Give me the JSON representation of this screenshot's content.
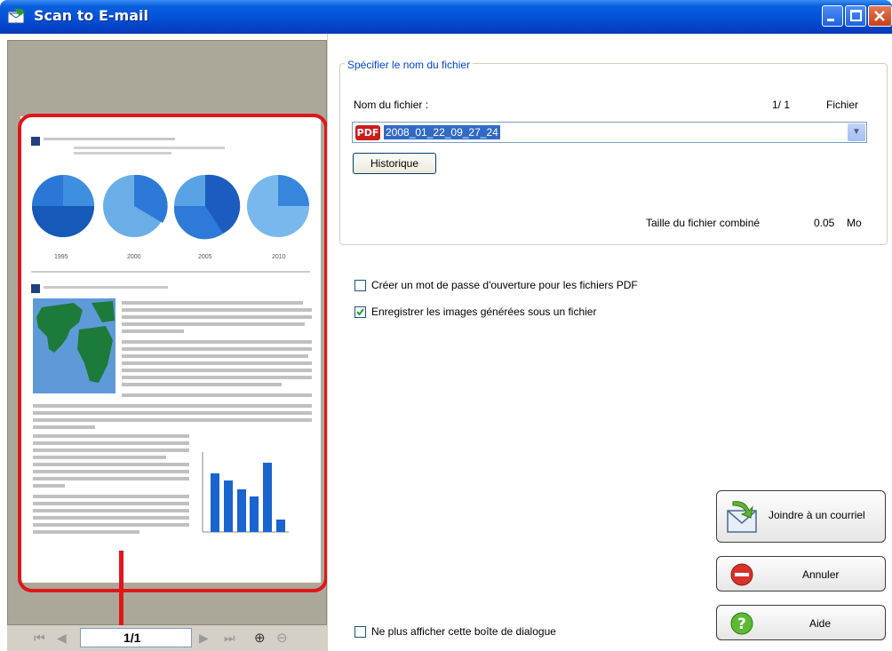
{
  "window": {
    "title": "Scan to E-mail"
  },
  "preview": {
    "page_indicator": "1/1",
    "chart_years": [
      "1995",
      "2000",
      "2005",
      "2010"
    ]
  },
  "file_group": {
    "legend": "Spécifier le nom du fichier",
    "filename_label": "Nom du fichier :",
    "file_counter": "1/ 1",
    "file_unit": "Fichier",
    "filename_value": "2008_01_22_09_27_24",
    "pdf_badge": "PDF",
    "history_button": "Historique",
    "combined_size_label": "Taille du fichier combiné",
    "combined_size_value": "0.05",
    "combined_size_unit": "Mo"
  },
  "options": {
    "password_label": "Créer un mot de passe d'ouverture pour les fichiers PDF",
    "password_checked": false,
    "save_images_label": "Enregistrer les images générées sous un fichier",
    "save_images_checked": true,
    "dont_show_label": "Ne plus afficher cette boîte de dialogue",
    "dont_show_checked": false
  },
  "buttons": {
    "attach": "Joindre à un courriel",
    "cancel": "Annuler",
    "help": "Aide"
  },
  "colors": {
    "accent": "#0046d5",
    "highlight": "#e0161b",
    "title_bar": "#0453d9"
  }
}
